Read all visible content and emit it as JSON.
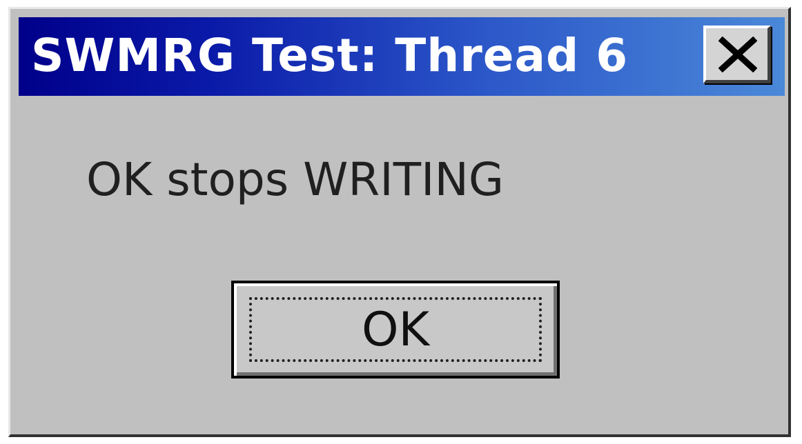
{
  "dialog": {
    "title": "SWMRG Test: Thread 6",
    "message": "OK stops WRITING",
    "ok_label": "OK",
    "close_icon": "close-icon"
  },
  "colors": {
    "titlebar_start": "#00008a",
    "titlebar_end": "#4a88d8",
    "dialog_face": "#c0c0c0",
    "title_text": "#ffffff"
  }
}
